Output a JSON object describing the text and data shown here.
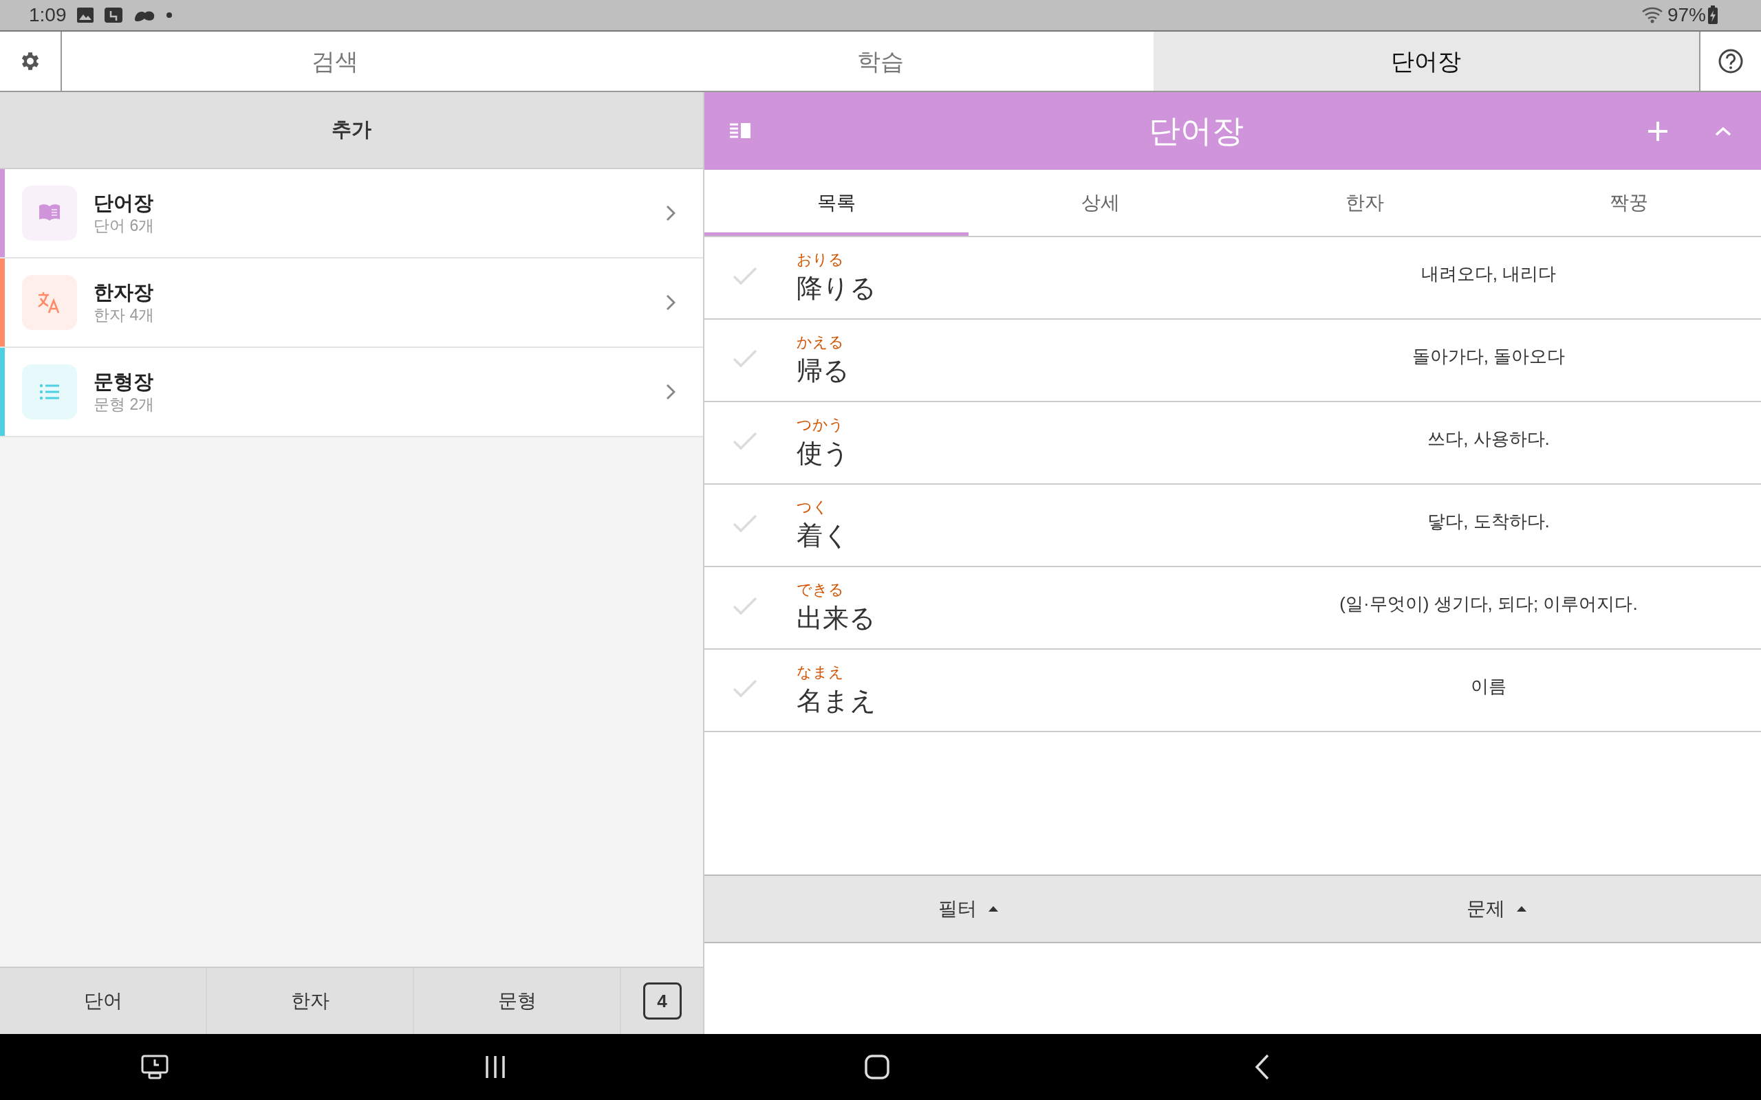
{
  "status_bar": {
    "time": "1:09",
    "battery": "97%"
  },
  "top_tabs": [
    {
      "label": "검색",
      "selected": false
    },
    {
      "label": "학습",
      "selected": false
    },
    {
      "label": "단어장",
      "selected": true
    }
  ],
  "left_panel": {
    "header": "추가",
    "items": [
      {
        "kind": "book",
        "title": "단어장",
        "subtitle": "단어 6개",
        "color": "#cf94da"
      },
      {
        "kind": "translate",
        "title": "한자장",
        "subtitle": "한자 4개",
        "color": "#ff8a65"
      },
      {
        "kind": "list",
        "title": "문형장",
        "subtitle": "문형 2개",
        "color": "#4dd0e1"
      }
    ],
    "bottom_tabs": [
      "단어",
      "한자",
      "문형"
    ],
    "count": "4"
  },
  "right_panel": {
    "title": "단어장",
    "tabs": [
      {
        "label": "목록",
        "selected": true
      },
      {
        "label": "상세",
        "selected": false
      },
      {
        "label": "한자",
        "selected": false
      },
      {
        "label": "짝꿍",
        "selected": false
      }
    ],
    "words": [
      {
        "reading": "おりる",
        "word": "降りる",
        "meaning": "내려오다, 내리다",
        "checked": false
      },
      {
        "reading": "かえる",
        "word": "帰る",
        "meaning": "돌아가다, 돌아오다",
        "checked": false
      },
      {
        "reading": "つかう",
        "word": "使う",
        "meaning": "쓰다, 사용하다.",
        "checked": false
      },
      {
        "reading": "つく",
        "word": "着く",
        "meaning": "닿다, 도착하다.",
        "checked": false
      },
      {
        "reading": "できる",
        "word": "出来る",
        "meaning": "(일·무엇이) 생기다, 되다; 이루어지다.",
        "checked": false
      },
      {
        "reading": "なまえ",
        "word": "名まえ",
        "meaning": "이름",
        "checked": false
      }
    ],
    "footer_buttons": [
      "필터",
      "문제"
    ]
  }
}
